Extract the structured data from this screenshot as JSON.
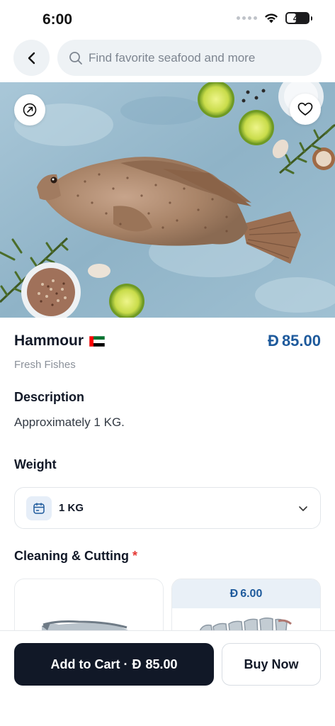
{
  "status_bar": {
    "time": "6:00",
    "battery": "42",
    "battery_level": 0.42
  },
  "search": {
    "placeholder": "Find favorite seafood and more"
  },
  "product": {
    "name": "Hammour",
    "origin_flag": "uae-flag",
    "price_symbol": "Đ",
    "price": "85.00",
    "category": "Fresh Fishes"
  },
  "description": {
    "title": "Description",
    "text": "Approximately 1 KG."
  },
  "weight": {
    "title": "Weight",
    "selected": "1 KG"
  },
  "cleaning": {
    "title": "Cleaning & Cutting",
    "required_mark": "*",
    "options": [
      {
        "price_symbol": "",
        "price": ""
      },
      {
        "price_symbol": "Đ",
        "price": "6.00"
      }
    ]
  },
  "actions": {
    "add_to_cart": "Add to Cart ·",
    "add_to_cart_symbol": "Đ",
    "add_to_cart_price": "85.00",
    "buy_now": "Buy Now"
  },
  "colors": {
    "accent": "#1e5a9c",
    "dark": "#111827",
    "required": "#e53935"
  },
  "icons": [
    "back-arrow-icon",
    "search-icon",
    "share-icon",
    "heart-icon",
    "calendar-box-icon",
    "chevron-down-icon",
    "wifi-icon",
    "battery-icon"
  ]
}
